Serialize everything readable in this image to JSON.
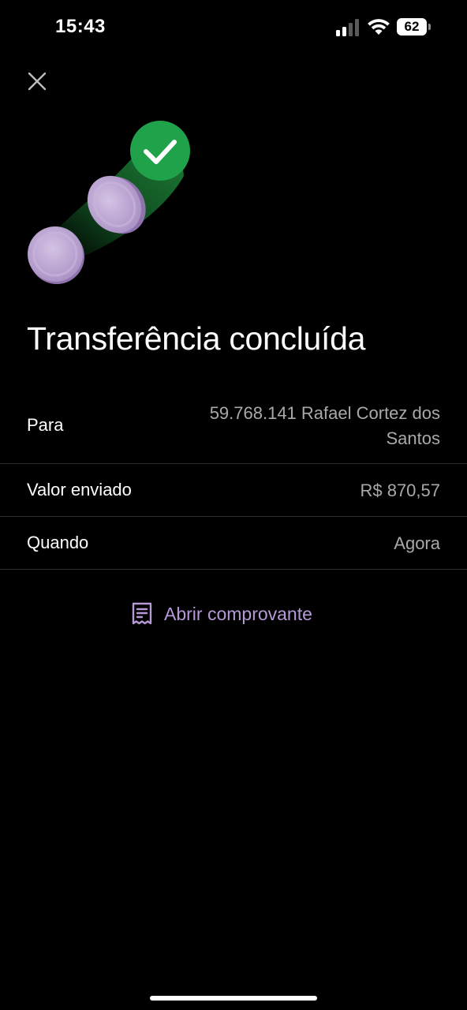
{
  "status_bar": {
    "time": "15:43",
    "battery_level": "62",
    "signal_icon": "signal-bars-icon",
    "wifi_icon": "wifi-icon",
    "battery_icon": "battery-icon"
  },
  "close_icon": "close-icon",
  "illustration": {
    "icon": "transfer-coins-check-icon",
    "check_color": "#1fa24a",
    "coin_color": "#b9a3cf"
  },
  "title": "Transferência concluída",
  "details": {
    "recipient": {
      "label": "Para",
      "value": "59.768.141 Rafael Cortez dos Santos"
    },
    "amount": {
      "label": "Valor enviado",
      "value": "R$ 870,57"
    },
    "when": {
      "label": "Quando",
      "value": "Agora"
    }
  },
  "receipt": {
    "label": "Abrir comprovante",
    "icon": "receipt-icon",
    "color": "#b59ad6"
  },
  "colors": {
    "background": "#000000",
    "text_primary": "#ffffff",
    "text_secondary": "#a9a9a9",
    "divider": "#2a2a2a",
    "accent": "#b59ad6",
    "success": "#1fa24a"
  }
}
